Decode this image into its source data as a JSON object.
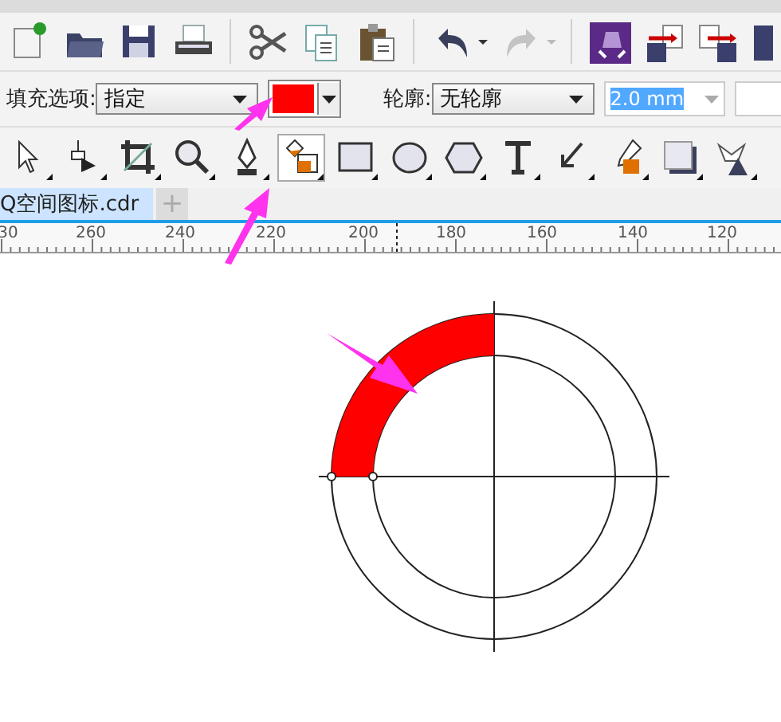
{
  "redo_disabled": true,
  "property_bar": {
    "fill_label": "填充选项:",
    "fill_option": "指定",
    "outline_label": "轮廓:",
    "outline_option": "无轮廓",
    "outline_width": "2.0 mm",
    "outline_width_disabled": true
  },
  "toolbox": [
    {
      "selected": false
    },
    {
      "selected": false
    },
    {
      "selected": false
    },
    {
      "selected": false
    },
    {
      "selected": false
    },
    {
      "selected": true
    },
    {
      "selected": false
    },
    {
      "selected": false
    },
    {
      "selected": false
    },
    {
      "selected": false
    },
    {
      "selected": false
    },
    {
      "selected": false
    },
    {
      "selected": false
    },
    {
      "selected": false
    }
  ],
  "tabs": [
    {
      "label": "Q空间图标.cdr",
      "selected": true
    }
  ],
  "new_tab": "+",
  "ruler": [
    "30",
    "260",
    "240",
    "220",
    "200",
    "180",
    "160",
    "140",
    "120"
  ]
}
